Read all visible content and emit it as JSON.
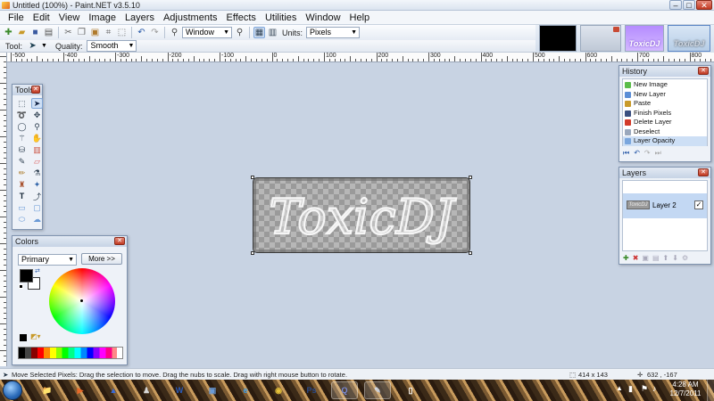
{
  "window": {
    "title": "Untitled (100%) - Paint.NET v3.5.10",
    "controls": [
      "–",
      "□",
      "✕"
    ]
  },
  "menu": [
    "File",
    "Edit",
    "View",
    "Image",
    "Layers",
    "Adjustments",
    "Effects",
    "Utilities",
    "Window",
    "Help"
  ],
  "toolbar": {
    "zoom_value": "Window",
    "units_label": "Units:",
    "units_value": "Pixels",
    "tool_label": "Tool:",
    "quality_label": "Quality:",
    "quality_value": "Smooth"
  },
  "thumbnails": [
    {
      "label": "",
      "bg": "#000000"
    },
    {
      "label": "",
      "bg": "#cfd7e2"
    },
    {
      "label": "ToxicDJ",
      "bg": "#c6a3ff"
    },
    {
      "label": "ToxicDJ",
      "bg": "#c9d9ea"
    }
  ],
  "ruler_labels": [
    "-500",
    "-400",
    "-300",
    "-200",
    "-100",
    "0",
    "100",
    "200",
    "300",
    "400",
    "500",
    "600",
    "700",
    "800"
  ],
  "canvas": {
    "text": "ToxicDJ"
  },
  "tools_window": {
    "title": "Tools"
  },
  "colors_window": {
    "title": "Colors",
    "mode_value": "Primary",
    "more_button": "More >>"
  },
  "history_window": {
    "title": "History",
    "items": [
      "New Image",
      "New Layer",
      "Paste",
      "Finish Pixels",
      "Delete Layer",
      "Deselect",
      "Layer Opacity"
    ],
    "selected_index": 6
  },
  "layers_window": {
    "title": "Layers",
    "layer_name": "Layer 2",
    "layer_thumb_text": "ToxicDJ",
    "checkmark": "✓"
  },
  "status": {
    "message": "Move Selected Pixels: Drag the selection to move. Drag the nubs to scale. Drag with right mouse button to rotate.",
    "size": "414 x 143",
    "position": "632 , -167"
  },
  "taskbar": {
    "time": "4:28 AM",
    "date": "12/7/2011",
    "apps": [
      {
        "name": "start-button",
        "glyph": "",
        "open": false
      },
      {
        "name": "explorer",
        "glyph": "📁",
        "open": false
      },
      {
        "name": "media-player",
        "glyph": "▶",
        "open": false
      },
      {
        "name": "app-arrow",
        "glyph": "▲",
        "open": false
      },
      {
        "name": "app-figure",
        "glyph": "♟",
        "open": false
      },
      {
        "name": "word",
        "glyph": "W",
        "open": false
      },
      {
        "name": "network",
        "glyph": "▣",
        "open": false
      },
      {
        "name": "ie",
        "glyph": "e",
        "open": false
      },
      {
        "name": "chrome",
        "glyph": "◉",
        "open": false
      },
      {
        "name": "photoshop",
        "glyph": "Ps",
        "open": false
      },
      {
        "name": "app-q",
        "glyph": "Q",
        "open": true
      },
      {
        "name": "paintnet",
        "glyph": "✎",
        "open": true
      },
      {
        "name": "blank-doc",
        "glyph": "▯",
        "open": false
      }
    ]
  }
}
